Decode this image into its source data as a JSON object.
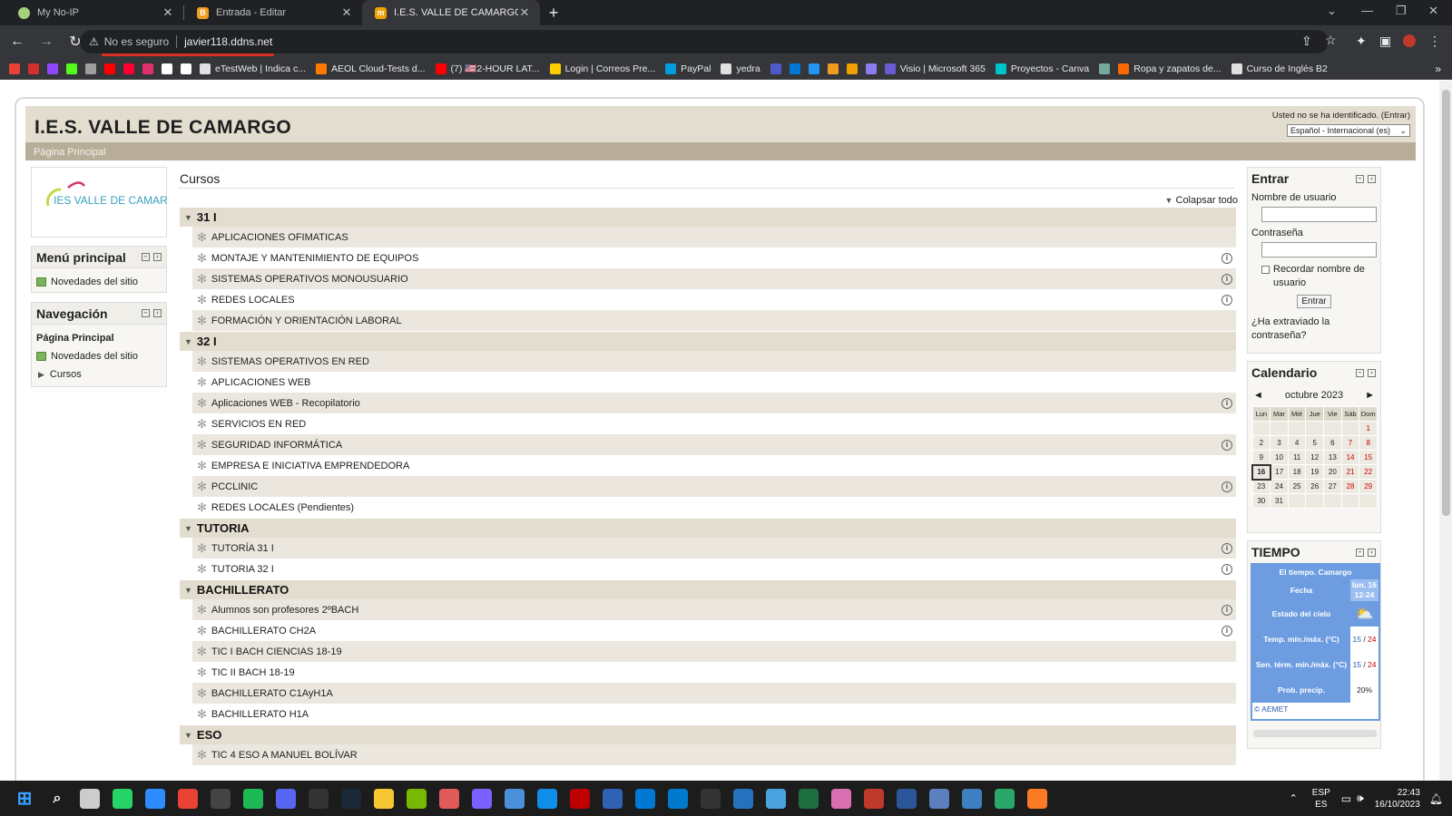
{
  "browser": {
    "tabs": [
      {
        "title": "My No-IP",
        "color": "#a6d07a",
        "active": false
      },
      {
        "title": "Entrada - Editar",
        "color": "#f29c1f",
        "active": false
      },
      {
        "title": "I.E.S. VALLE DE CAMARGO",
        "color": "#f0a000",
        "active": true
      }
    ],
    "new_tab": "+",
    "security_label": "No es seguro",
    "url": "javier118.ddns.net",
    "bookmarks": [
      {
        "label": "",
        "color": "#ea4335"
      },
      {
        "label": "",
        "color": "#d32f2f"
      },
      {
        "label": "",
        "color": "#9146ff"
      },
      {
        "label": "",
        "color": "#53fc18"
      },
      {
        "label": "",
        "color": "#9e9e9e"
      },
      {
        "label": "",
        "color": "#ff0000"
      },
      {
        "label": "",
        "color": "#ff0033"
      },
      {
        "label": "",
        "color": "#e1306c"
      },
      {
        "label": "",
        "color": "#ffffff"
      },
      {
        "label": "",
        "color": "#ffffff"
      },
      {
        "label": "eTestWeb | Indica c...",
        "color": "#e0e0e0"
      },
      {
        "label": "AEOL Cloud-Tests d...",
        "color": "#ff7a00"
      },
      {
        "label": "(7) 🇺🇸2-HOUR LAT...",
        "color": "#ff0000"
      },
      {
        "label": "Login | Correos Pre...",
        "color": "#ffcc00"
      },
      {
        "label": "PayPal",
        "color": "#009cde"
      },
      {
        "label": "yedra",
        "color": "#e0e0e0"
      },
      {
        "label": "",
        "color": "#5059c9"
      },
      {
        "label": "",
        "color": "#0078d4"
      },
      {
        "label": "",
        "color": "#2196f3"
      },
      {
        "label": "",
        "color": "#f29c1f"
      },
      {
        "label": "",
        "color": "#f0a000"
      },
      {
        "label": "",
        "color": "#8c7cf0"
      },
      {
        "label": "Visio | Microsoft 365",
        "color": "#6b5bd2"
      },
      {
        "label": "Proyectos - Canva",
        "color": "#00c4cc"
      },
      {
        "label": "",
        "color": "#74aa9c"
      },
      {
        "label": "Ropa y zapatos de...",
        "color": "#ff6a00"
      },
      {
        "label": "Curso de Inglés B2",
        "color": "#e0e0e0"
      }
    ]
  },
  "site": {
    "title": "I.E.S. VALLE DE CAMARGO",
    "login_status": "Usted no se ha identificado. (Entrar)",
    "language": "Español - Internacional (es)",
    "breadcrumb": "Página Principal",
    "logo_text": "IES VALLE DE CAMARGO"
  },
  "left": {
    "menu": {
      "title": "Menú principal",
      "items": [
        "Novedades del sitio"
      ]
    },
    "nav": {
      "title": "Navegación",
      "home": "Página Principal",
      "items": [
        "Novedades del sitio",
        "Cursos"
      ]
    }
  },
  "main": {
    "title": "Cursos",
    "collapse_all": "Colapsar todo",
    "categories": [
      {
        "name": "31 I",
        "courses": [
          {
            "name": "APLICACIONES OFIMATICAS",
            "info": false
          },
          {
            "name": "MONTAJE Y MANTENIMIENTO DE EQUIPOS",
            "info": true
          },
          {
            "name": "SISTEMAS OPERATIVOS MONOUSUARIO",
            "info": true
          },
          {
            "name": "REDES LOCALES",
            "info": true
          },
          {
            "name": "FORMACIÓN Y ORIENTACIÓN LABORAL",
            "info": false
          }
        ]
      },
      {
        "name": "32 I",
        "courses": [
          {
            "name": "SISTEMAS OPERATIVOS EN RED",
            "info": false
          },
          {
            "name": "APLICACIONES WEB",
            "info": false
          },
          {
            "name": "Aplicaciones WEB - Recopilatorio",
            "info": true
          },
          {
            "name": "SERVICIOS EN RED",
            "info": false
          },
          {
            "name": "SEGURIDAD INFORMÁTICA",
            "info": true
          },
          {
            "name": "EMPRESA E INICIATIVA EMPRENDEDORA",
            "info": false
          },
          {
            "name": "PCCLINIC",
            "info": true
          },
          {
            "name": "REDES LOCALES (Pendientes)",
            "info": false
          }
        ]
      },
      {
        "name": "TUTORIA",
        "courses": [
          {
            "name": "TUTORÍA 31 I",
            "info": true
          },
          {
            "name": "TUTORIA 32 I",
            "info": true
          }
        ]
      },
      {
        "name": "BACHILLERATO",
        "courses": [
          {
            "name": "Alumnos son profesores 2ºBACH",
            "info": true
          },
          {
            "name": "BACHILLERATO CH2A",
            "info": true
          },
          {
            "name": "TIC I BACH CIENCIAS 18-19",
            "info": false
          },
          {
            "name": "TIC II BACH 18-19",
            "info": false
          },
          {
            "name": "BACHILLERATO C1AyH1A",
            "info": false
          },
          {
            "name": "BACHILLERATO H1A",
            "info": false
          }
        ]
      },
      {
        "name": "ESO",
        "courses": [
          {
            "name": "TIC 4 ESO A MANUEL BOLÍVAR",
            "info": false
          }
        ]
      }
    ]
  },
  "right": {
    "login": {
      "title": "Entrar",
      "username_label": "Nombre de usuario",
      "password_label": "Contraseña",
      "remember_label": "Recordar nombre de usuario",
      "submit": "Entrar",
      "forgot": "¿Ha extraviado la contraseña?"
    },
    "calendar": {
      "title": "Calendario",
      "month": "octubre 2023",
      "prev": "◄",
      "next": "►",
      "weekdays": [
        "Lun",
        "Mar",
        "Mié",
        "Jue",
        "Vie",
        "Sáb",
        "Dom"
      ],
      "weeks": [
        [
          "",
          "",
          "",
          "",
          "",
          "",
          "1"
        ],
        [
          "2",
          "3",
          "4",
          "5",
          "6",
          "7",
          "8"
        ],
        [
          "9",
          "10",
          "11",
          "12",
          "13",
          "14",
          "15"
        ],
        [
          "16",
          "17",
          "18",
          "19",
          "20",
          "21",
          "22"
        ],
        [
          "23",
          "24",
          "25",
          "26",
          "27",
          "28",
          "29"
        ],
        [
          "30",
          "31",
          "",
          "",
          "",
          "",
          ""
        ]
      ],
      "today": "16"
    },
    "weather": {
      "title": "TIEMPO",
      "header": "El tiempo. Camargo",
      "date_label": "Fecha",
      "date_value": "lun. 16",
      "date_hours": "12-24",
      "sky_label": "Estado del cielo",
      "temp_label": "Temp. mín./máx. (°C)",
      "temp_min": "15",
      "temp_max": "24",
      "feel_label": "Sen. térm. mín./máx. (°C)",
      "feel_min": "15",
      "feel_max": "24",
      "precip_label": "Prob. precip.",
      "precip_value": "20%",
      "source": "© AEMET"
    }
  },
  "taskbar": {
    "lang_top": "ESP",
    "lang_bottom": "ES",
    "time": "22:43",
    "date": "16/10/2023",
    "apps": [
      {
        "icon": "windows-start-icon",
        "color": "#3aa0ff"
      },
      {
        "icon": "search-icon",
        "color": "#1c1c1c"
      },
      {
        "icon": "task-view-icon",
        "color": "#cccccc"
      },
      {
        "icon": "whatsapp-icon",
        "color": "#25d366"
      },
      {
        "icon": "zoom-icon",
        "color": "#2d8cff"
      },
      {
        "icon": "chrome-icon",
        "color": "#ea4335"
      },
      {
        "icon": "obs-icon",
        "color": "#444444"
      },
      {
        "icon": "spotify-icon",
        "color": "#1db954"
      },
      {
        "icon": "discord-icon",
        "color": "#5865f2"
      },
      {
        "icon": "epic-games-icon",
        "color": "#333333"
      },
      {
        "icon": "steam-icon",
        "color": "#1b2838"
      },
      {
        "icon": "file-explorer-icon",
        "color": "#f8c633"
      },
      {
        "icon": "nvidia-icon",
        "color": "#76b900"
      },
      {
        "icon": "snipping-tool-icon",
        "color": "#e05a5a"
      },
      {
        "icon": "clipchamp-icon",
        "color": "#7b61ff"
      },
      {
        "icon": "calculator-icon",
        "color": "#4a90d9"
      },
      {
        "icon": "teamviewer-icon",
        "color": "#0e8ee9"
      },
      {
        "icon": "filezilla-icon",
        "color": "#bf0000"
      },
      {
        "icon": "virtualbox-icon",
        "color": "#2f61b4"
      },
      {
        "icon": "store-icon",
        "color": "#0078d4"
      },
      {
        "icon": "vscode-icon",
        "color": "#007acc"
      },
      {
        "icon": "terminal-icon",
        "color": "#333333"
      },
      {
        "icon": "powershell-icon",
        "color": "#2671be"
      },
      {
        "icon": "remote-desktop-icon",
        "color": "#4aa3df"
      },
      {
        "icon": "excel-icon",
        "color": "#1d6f42"
      },
      {
        "icon": "paint-icon",
        "color": "#d96fb0"
      },
      {
        "icon": "access-icon",
        "color": "#c0392b"
      },
      {
        "icon": "word-icon",
        "color": "#2b579a"
      },
      {
        "icon": "network-icon",
        "color": "#5b7fbf"
      },
      {
        "icon": "wireshark-icon",
        "color": "#3d7fc1"
      },
      {
        "icon": "packet-tracer-icon",
        "color": "#2aa86a"
      },
      {
        "icon": "xampp-icon",
        "color": "#fb7a24"
      }
    ]
  }
}
